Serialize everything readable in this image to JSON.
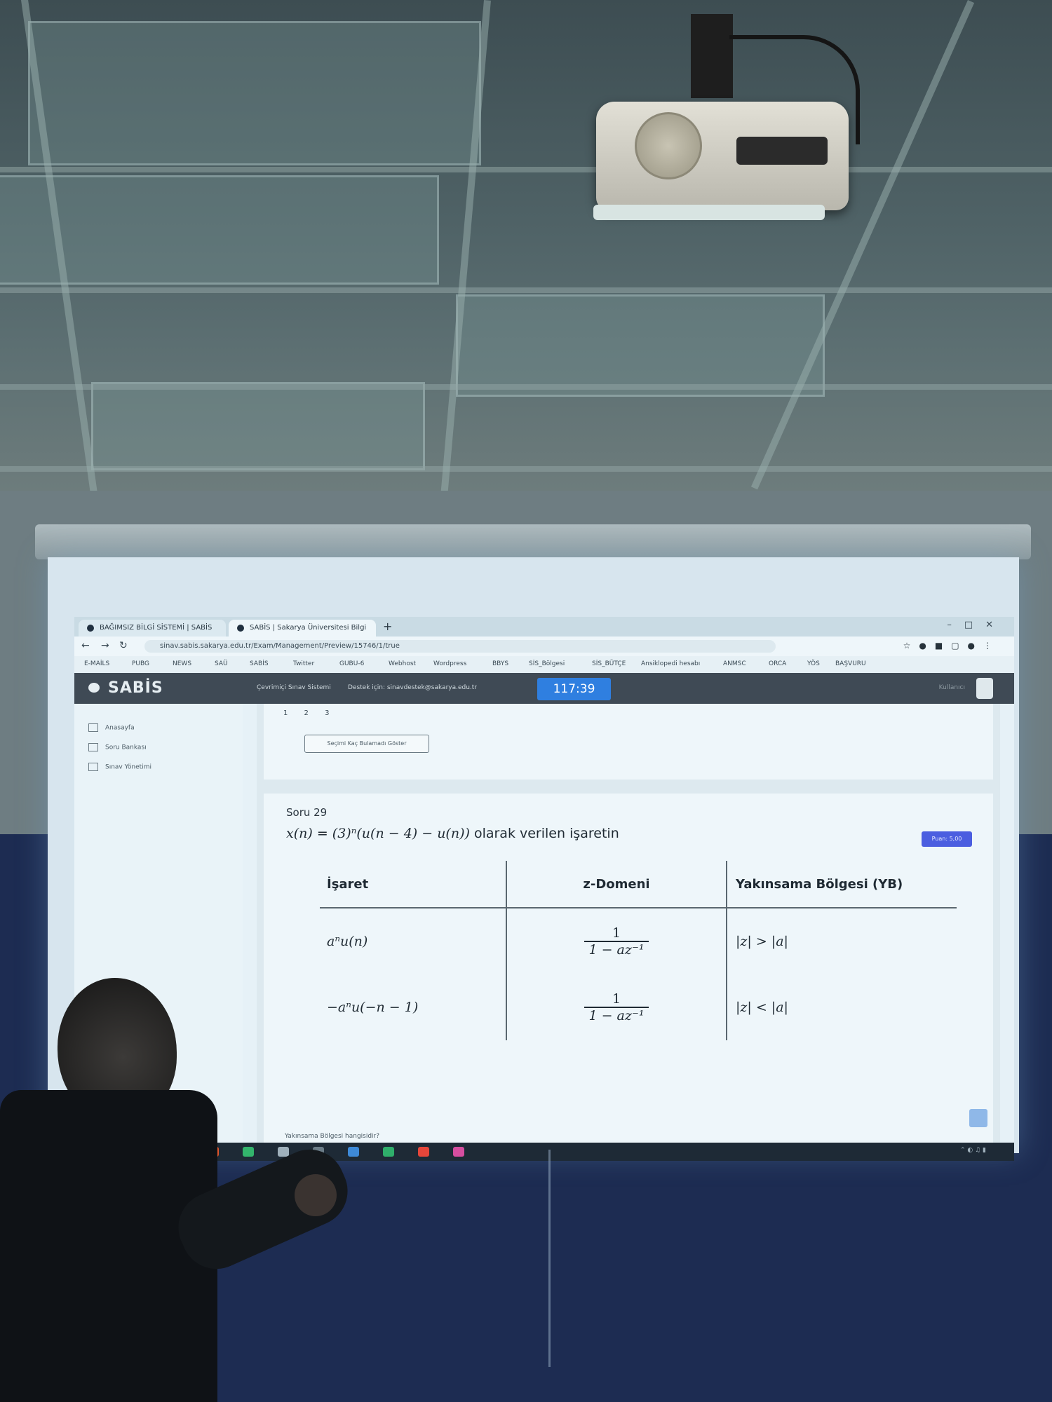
{
  "browser": {
    "tabs": [
      "BAĞIMSIZ BİLGİ SİSTEMİ | SABİS",
      "SABİS | Sakarya Üniversitesi Bilgi"
    ],
    "url": "sinav.sabis.sakarya.edu.tr/Exam/Management/Preview/15746/1/true",
    "bookmarks": [
      "E-MAİLS",
      "PUBG",
      "NEWS",
      "SAÜ",
      "SABİS",
      "Twitter",
      "GUBU-6",
      "Webhost",
      "Wordpress",
      "BBYS",
      "SİS_Bölgesi",
      "SİS_BÜTÇE",
      "Ansiklopedi hesabı",
      "ANMSC",
      "ORCA",
      "YÖS",
      "BAŞVURU"
    ]
  },
  "app": {
    "logo": "SABİS",
    "nav_links": [
      "Çevrimiçi Sınav Sistemi",
      "Destek için: sinavdestek@sakarya.edu.tr"
    ],
    "timer": "117:39",
    "user": "Kullanıcı"
  },
  "sidebar": {
    "items": [
      "Anasayfa",
      "Soru Bankası",
      "Sınav Yönetimi"
    ]
  },
  "question": {
    "pager": "1 2 3",
    "outline_button": "Seçimi Kaç Bulamadı Göster",
    "number": "Soru 29",
    "formula": "x(n) = (3)ⁿ(u(n − 4) − u(n))",
    "text": " olarak verilen işaretin",
    "flag_button": "Puan: 5,00",
    "answer_prompt": "Yakınsama Bölgesi hangisidir?"
  },
  "table": {
    "headers": [
      "İşaret",
      "z-Domeni",
      "Yakınsama Bölgesi (YB)"
    ],
    "rows": [
      {
        "signal": "aⁿu(n)",
        "num": "1",
        "den": "1 − az⁻¹",
        "roc": "|z| > |a|"
      },
      {
        "signal": "−aⁿu(−n − 1)",
        "num": "1",
        "den": "1 − az⁻¹",
        "roc": "|z| < |a|"
      }
    ]
  }
}
